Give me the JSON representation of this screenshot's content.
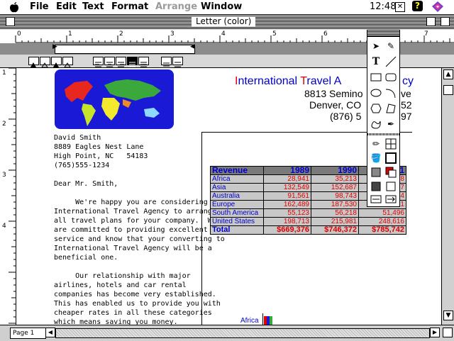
{
  "menubar": {
    "apple": "",
    "items": [
      {
        "label": "File",
        "disabled": false
      },
      {
        "label": "Edit",
        "disabled": false
      },
      {
        "label": "Text",
        "disabled": false
      },
      {
        "label": "Format",
        "disabled": false
      },
      {
        "label": "Arrange",
        "disabled": true
      },
      {
        "label": "Window",
        "disabled": false
      }
    ],
    "clock": "12:48"
  },
  "window": {
    "title": "Letter (color)"
  },
  "ruler": {
    "numbers": [
      "0",
      "1",
      "2",
      "3",
      "4",
      "5",
      "6",
      "7"
    ],
    "v_numbers": [
      "1",
      "2",
      "3",
      "4"
    ]
  },
  "letterhead": {
    "company_part1": "I",
    "company_part2": "nternational ",
    "company_part3": "T",
    "company_part4": "ravel A",
    "company_part5": "cy",
    "addr1": "8813 Semino",
    "addr1_end": "ve",
    "addr2": "Denver, CO",
    "addr2_end": "52",
    "phone": "(876) 5",
    "phone_end": "97"
  },
  "recipient": {
    "name": "David Smith",
    "street": "8889 Eagles Nest Lane",
    "city": "High Point, NC   54183",
    "phone": "(765)555-1234"
  },
  "letter": {
    "salutation": "Dear Mr. Smith,",
    "p1": [
      "     We're happy you are considering",
      "International Travel Agency to arrange",
      "all travel plans for your company.  We",
      "are committed to providing excellent",
      "service and know that your converting to",
      "International Travel Agency will be a",
      "beneficial one."
    ],
    "p2": [
      "     Our relationship with major",
      "airlines, hotels and car rental",
      "companies has become very established.",
      "This has enabled us to provide you with",
      "cheaper rates in all these categories",
      "which means saving you money."
    ]
  },
  "revenue_table": {
    "header": [
      "Revenue",
      "1989",
      "1990",
      "91"
    ],
    "rows": [
      {
        "region": "Africa",
        "values": [
          "28,941",
          "35,213",
          "58"
        ]
      },
      {
        "region": "Asia",
        "values": [
          "132,549",
          "152,687",
          "57"
        ]
      },
      {
        "region": "Australia",
        "values": [
          "91,561",
          "98,743",
          "24"
        ]
      },
      {
        "region": "Europe",
        "values": [
          "162,489",
          "187,530",
          "215,981"
        ]
      },
      {
        "region": "South America",
        "values": [
          "55,123",
          "56,218",
          "51,496"
        ]
      },
      {
        "region": "United States",
        "values": [
          "198,713",
          "215,981",
          "248,616"
        ]
      }
    ],
    "total": {
      "label": "Total",
      "values": [
        "$669,376",
        "$746,372",
        "$785,742"
      ]
    }
  },
  "chart_label": "Africa",
  "status": {
    "page": "Page 1"
  },
  "colors": {
    "blue_text": "#0000cc",
    "red_text": "#e00000",
    "map_bg": "#1a1ad6"
  }
}
